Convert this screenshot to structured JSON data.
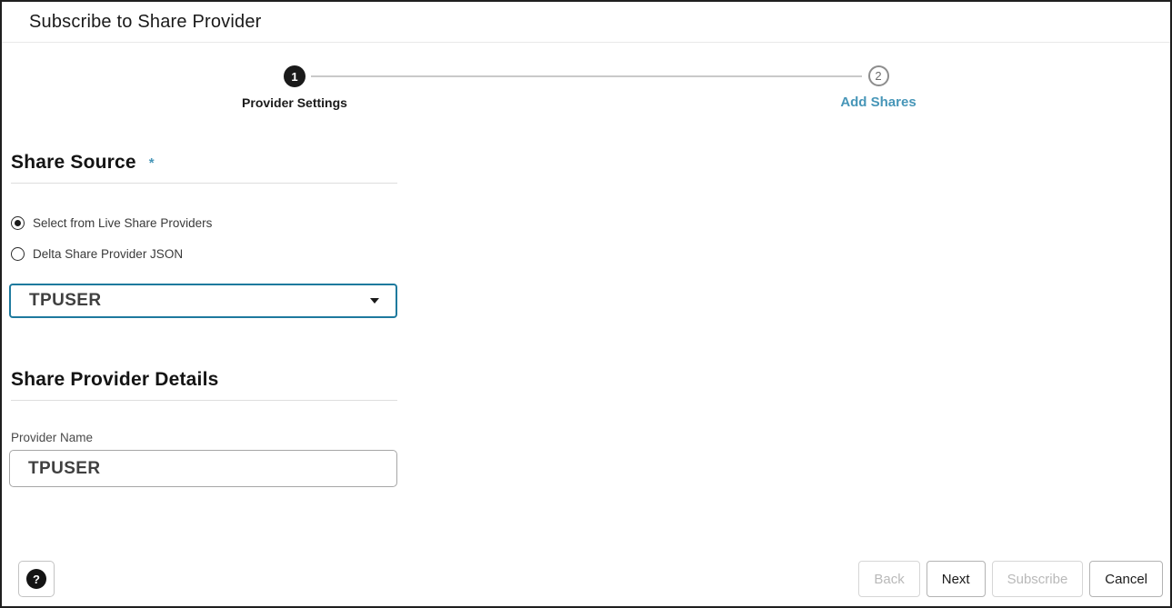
{
  "window": {
    "title": "Subscribe to Share Provider"
  },
  "stepper": {
    "steps": [
      {
        "number": "1",
        "label": "Provider Settings",
        "state": "active"
      },
      {
        "number": "2",
        "label": "Add Shares",
        "state": "upcoming"
      }
    ]
  },
  "share_source": {
    "heading": "Share Source",
    "required_marker": "*",
    "options": [
      {
        "label": "Select from Live Share Providers",
        "selected": true
      },
      {
        "label": "Delta Share Provider JSON",
        "selected": false
      }
    ],
    "provider_select": {
      "value": "TPUSER"
    }
  },
  "provider_details": {
    "heading": "Share Provider Details",
    "provider_name": {
      "label": "Provider Name",
      "value": "TPUSER"
    }
  },
  "footer": {
    "help_glyph": "?",
    "buttons": [
      {
        "label": "Back",
        "enabled": false
      },
      {
        "label": "Next",
        "enabled": true
      },
      {
        "label": "Subscribe",
        "enabled": false
      },
      {
        "label": "Cancel",
        "enabled": true
      }
    ]
  },
  "colors": {
    "accent_teal": "#4796b8",
    "select_focus_border": "#1e7a9e",
    "step_active_fill": "#1a1a1a",
    "step_upcoming_border": "#8d8d8d"
  }
}
